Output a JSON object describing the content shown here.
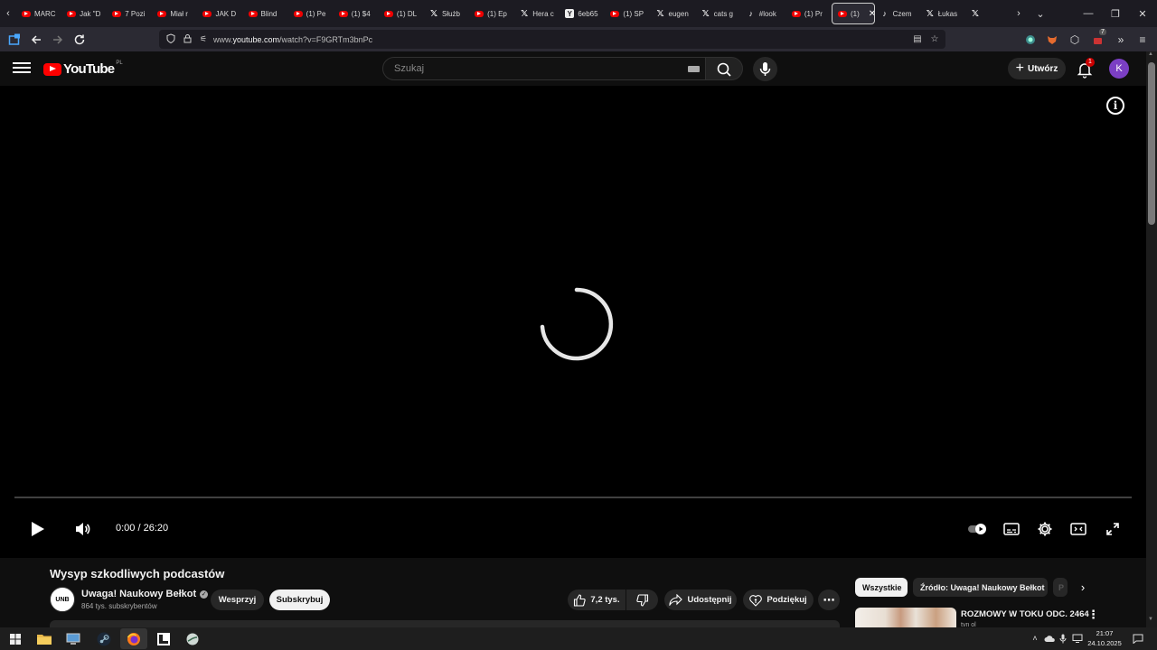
{
  "browser": {
    "tabs": [
      {
        "label": "MARC",
        "icon": "youtube-icon"
      },
      {
        "label": "Jak \"D",
        "icon": "youtube-icon"
      },
      {
        "label": "7 Pozi",
        "icon": "youtube-icon"
      },
      {
        "label": "Miał r",
        "icon": "youtube-icon"
      },
      {
        "label": "JAK D",
        "icon": "youtube-icon"
      },
      {
        "label": "Blind",
        "icon": "youtube-icon"
      },
      {
        "label": "(1) Pe",
        "icon": "youtube-icon"
      },
      {
        "label": "(1) $4",
        "icon": "youtube-icon"
      },
      {
        "label": "(1) DL",
        "icon": "youtube-icon"
      },
      {
        "label": "Służb",
        "icon": "x-icon"
      },
      {
        "label": "(1) Ep",
        "icon": "youtube-icon"
      },
      {
        "label": "Hera c",
        "icon": "x-icon"
      },
      {
        "label": "6eb65",
        "icon": "y-site-icon"
      },
      {
        "label": "(1) SP",
        "icon": "youtube-icon"
      },
      {
        "label": "eugen",
        "icon": "x-icon"
      },
      {
        "label": "cats g",
        "icon": "x-icon"
      },
      {
        "label": "#look",
        "icon": "tiktok-icon"
      },
      {
        "label": "(1) Pr",
        "icon": "youtube-icon"
      },
      {
        "label": "(1)",
        "icon": "youtube-icon",
        "active": true
      },
      {
        "label": "Czem",
        "icon": "tiktok-icon"
      },
      {
        "label": "Łukas",
        "icon": "x-icon"
      },
      {
        "label": "",
        "icon": "x-icon"
      }
    ],
    "url_prefix": "www.",
    "url_host": "youtube.com",
    "url_path": "/watch?v=F9GRTm3bnPc",
    "extension_badge": "7"
  },
  "youtube": {
    "logo_text": "YouTube",
    "country_code": "PL",
    "search_placeholder": "Szukaj",
    "create_label": "Utwórz",
    "notification_count": "1",
    "avatar_letter": "K"
  },
  "player": {
    "current_time": "0:00",
    "duration": "26:20",
    "time_display": "0:00 / 26:20",
    "progress": 0,
    "state": "loading"
  },
  "video": {
    "title": "Wysyp szkodliwych podcastów",
    "channel_name": "Uwaga! Naukowy Bełkot",
    "channel_logo_text": "UNB",
    "subscribers": "864 tys. subskrybentów",
    "support_label": "Wesprzyj",
    "subscribe_label": "Subskrybuj",
    "likes": "7,2 tys.",
    "share_label": "Udostępnij",
    "thanks_label": "Podziękuj"
  },
  "sidebar": {
    "chips": [
      "Wszystkie",
      "Źródło: Uwaga! Naukowy Bełkot",
      "P"
    ],
    "recommendation": {
      "title": "ROZMOWY W TOKU ODC. 2464",
      "channel": "tvn ol"
    }
  },
  "taskbar": {
    "time": "21:07",
    "date": "24.10.2025"
  },
  "colors": {
    "youtube_red": "#ff0000",
    "avatar_purple": "#7b3fc4",
    "background": "#0f0f0f"
  }
}
